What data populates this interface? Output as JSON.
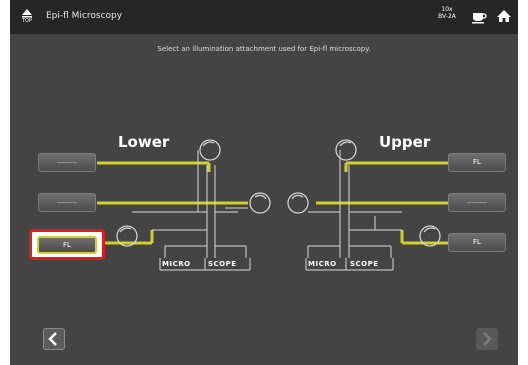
{
  "header": {
    "top_label": "TOP",
    "title": "Epi-fl Microscopy",
    "objective": {
      "magnification": "10x",
      "name": "BV-2A"
    }
  },
  "instruction": "Select an illumination attachment used for Epi-fl microscopy.",
  "lower": {
    "label": "Lower",
    "ports": [
      {
        "label": ""
      },
      {
        "label": ""
      },
      {
        "label": "FL",
        "selected": true
      }
    ]
  },
  "upper": {
    "label": "Upper",
    "ports": [
      {
        "label": "FL"
      },
      {
        "label": ""
      },
      {
        "label": "FL"
      }
    ]
  },
  "microscope_labels": {
    "left": [
      "MICRO",
      "SCOPE"
    ],
    "right": [
      "MICRO",
      "SCOPE"
    ]
  },
  "colors": {
    "background": "#444444",
    "titlebar": "#262626",
    "path_active": "#cfd12a",
    "path_inactive": "#d8d8d8",
    "selection": "#e01b1b"
  },
  "icons": [
    "top-icon",
    "cup-icon",
    "home-icon",
    "chevron-left-icon",
    "chevron-right-icon"
  ]
}
